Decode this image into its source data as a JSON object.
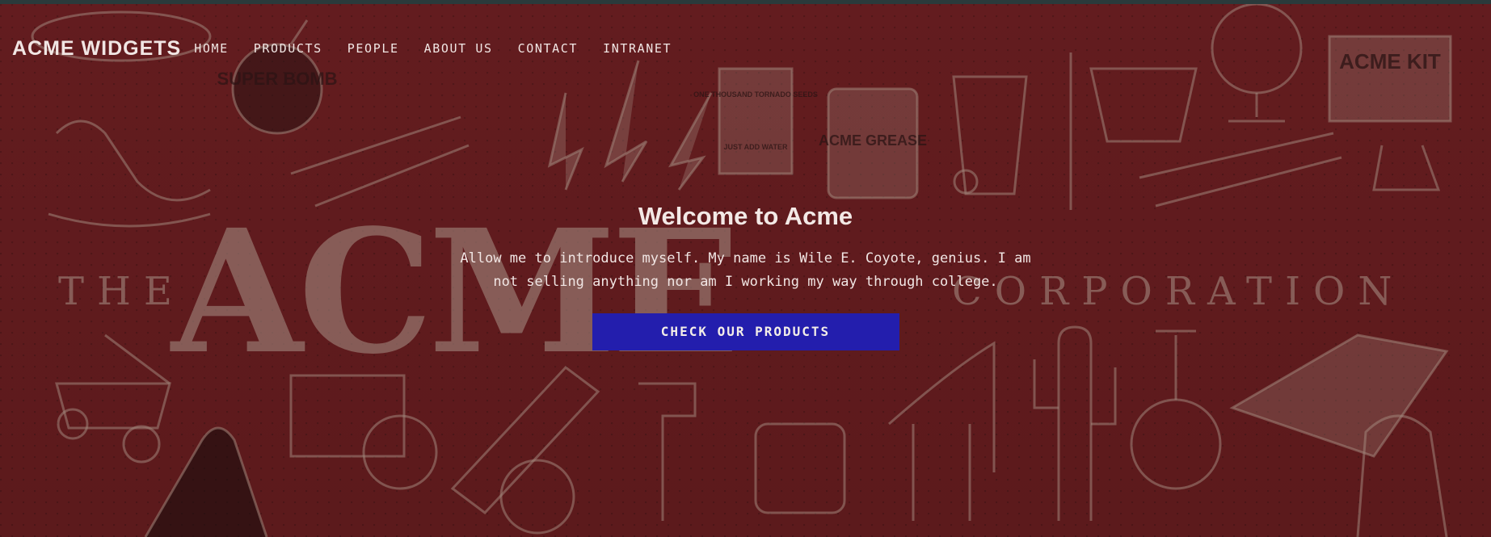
{
  "brand": {
    "name": "ACME WIDGETS"
  },
  "nav": {
    "items": [
      {
        "label": "HOME"
      },
      {
        "label": "PRODUCTS"
      },
      {
        "label": "PEOPLE"
      },
      {
        "label": "ABOUT US"
      },
      {
        "label": "CONTACT"
      },
      {
        "label": "INTRANET"
      }
    ]
  },
  "hero": {
    "title": "Welcome to Acme",
    "intro": "Allow me to introduce myself. My name is Wile E. Coyote, genius. I am not selling anything nor am I working my way through college.",
    "cta_label": "CHECK OUR PRODUCTS"
  },
  "background": {
    "image_name": "acme-corporation-illustration",
    "overlay_color": "#5e1b1d",
    "logo_text_left": "THE",
    "logo_text_main": "ACME",
    "logo_text_right": "CORPORATION",
    "product_labels": [
      "SUPER BOMB",
      "ONE THOUSAND TORNADO SEEDS",
      "JUST ADD WATER",
      "ACME GREASE",
      "ACME KIT"
    ]
  },
  "colors": {
    "accent": "#231ead",
    "text": "#f1e6e4",
    "illustration": "#a0857a"
  }
}
